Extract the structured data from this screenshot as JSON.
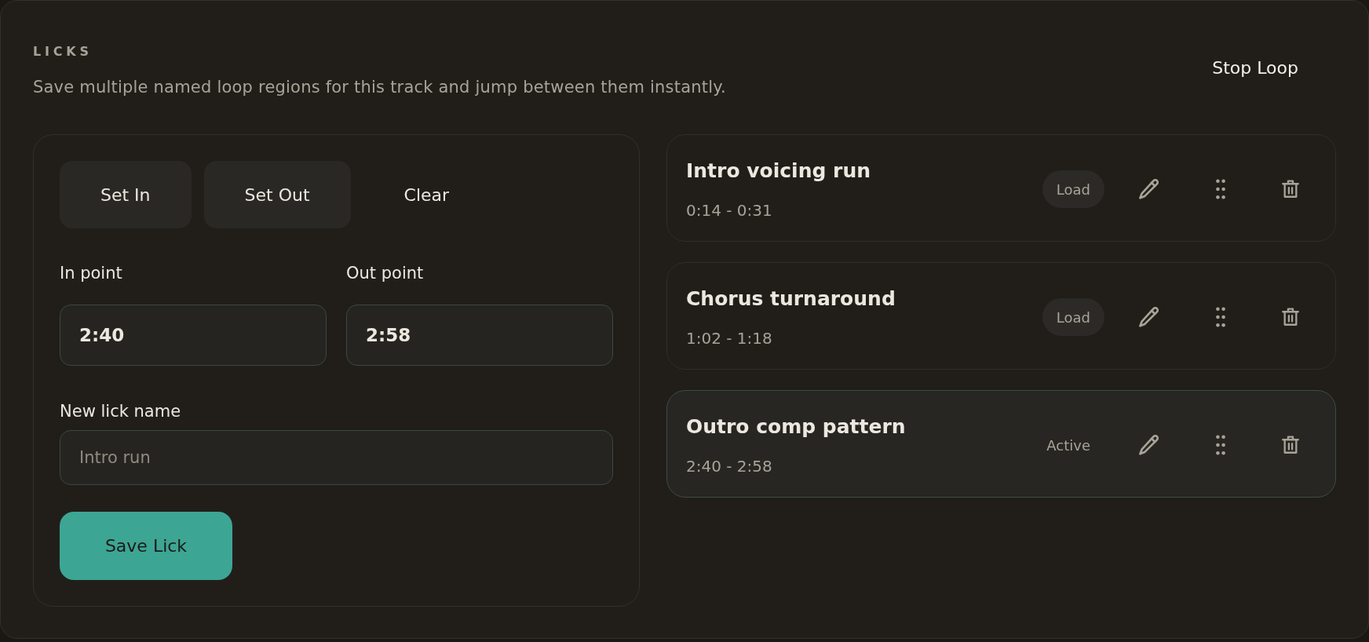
{
  "header": {
    "eyebrow": "LICKS",
    "description": "Save multiple named loop regions for this track and jump between them instantly.",
    "stop_button": "Stop Loop"
  },
  "editor": {
    "buttons": [
      {
        "label": "Set In",
        "kind": "filled"
      },
      {
        "label": "Set Out",
        "kind": "filled"
      },
      {
        "label": "Clear",
        "kind": "plain"
      }
    ],
    "fields": [
      {
        "label": "In point",
        "value": "2:40"
      },
      {
        "label": "Out point",
        "value": "2:58"
      }
    ],
    "name_field": {
      "label": "New lick name",
      "placeholder": "Intro run"
    },
    "save_button": "Save Lick"
  },
  "licks": [
    {
      "name": "Intro voicing run",
      "range": "0:14 - 0:31",
      "action": "Load",
      "selected": false
    },
    {
      "name": "Chorus turnaround",
      "range": "1:02 - 1:18",
      "action": "Load",
      "selected": false
    },
    {
      "name": "Outro comp pattern",
      "range": "2:40 - 2:58",
      "action": "Active",
      "selected": true
    }
  ]
}
